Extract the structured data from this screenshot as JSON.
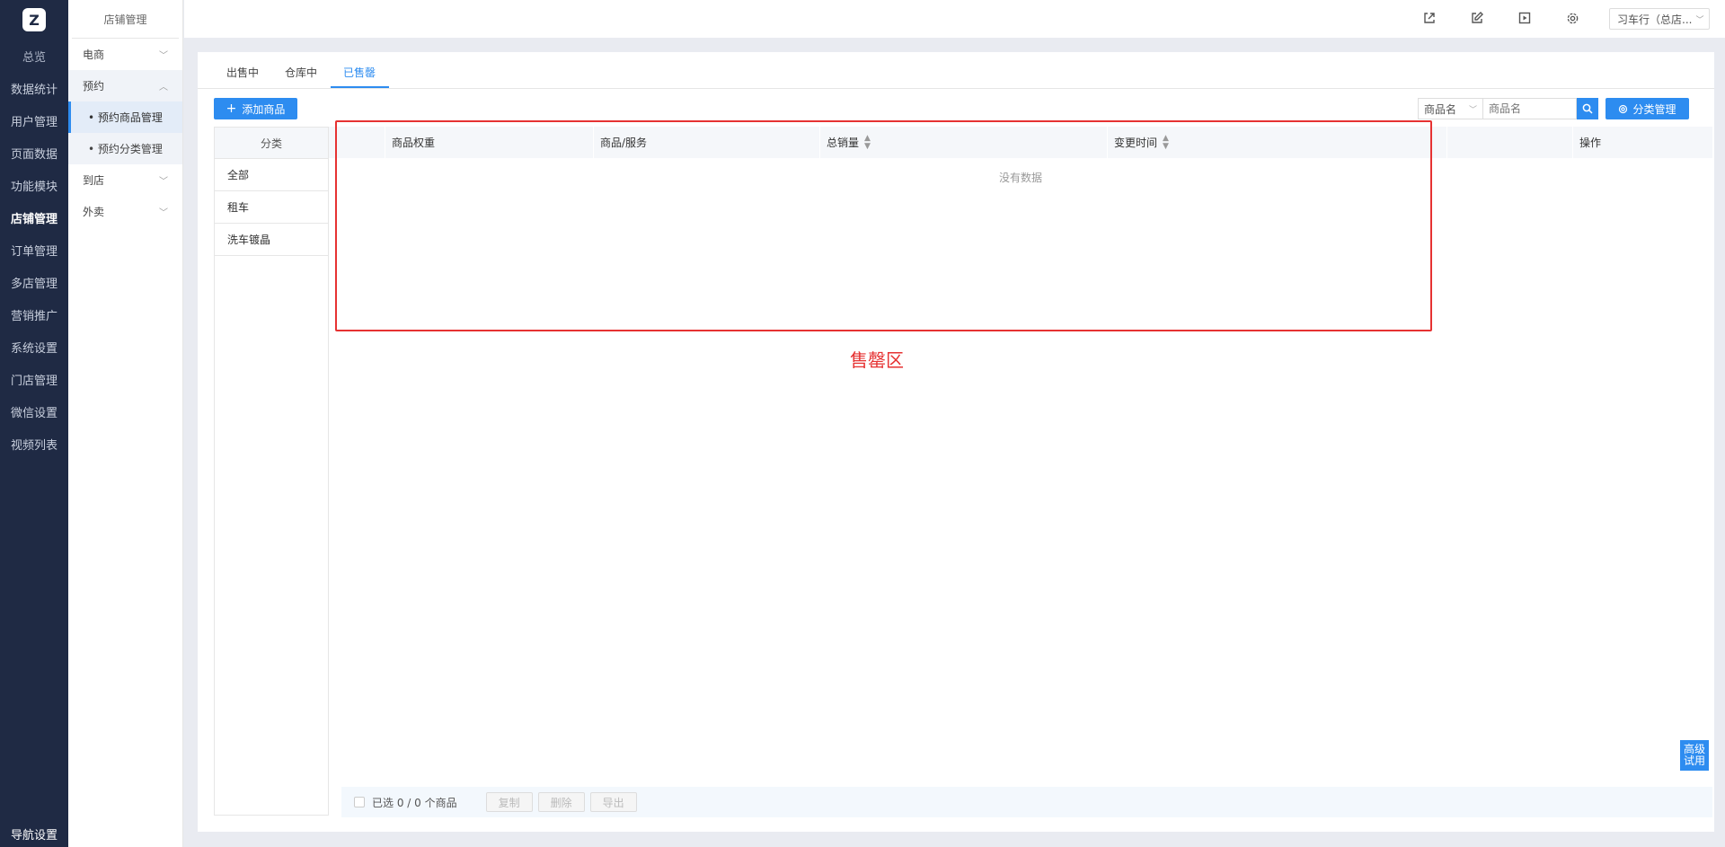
{
  "rail": {
    "items": [
      "总览",
      "数据统计",
      "用户管理",
      "页面数据",
      "功能模块",
      "店铺管理",
      "订单管理",
      "多店管理",
      "营销推广",
      "系统设置",
      "门店管理",
      "微信设置",
      "视频列表"
    ],
    "bottom": "导航设置"
  },
  "sub": {
    "title": "店铺管理",
    "groups": [
      "电商",
      "预约",
      "到店",
      "外卖"
    ],
    "leaves": [
      "• 预约商品管理",
      "• 预约分类管理"
    ]
  },
  "topbar": {
    "store": "习车行（总店..."
  },
  "tabs": [
    "出售中",
    "仓库中",
    "已售罄"
  ],
  "toolbar": {
    "add_label": "添加商品",
    "search_field": "商品名",
    "search_placeholder": "商品名",
    "category_label": "分类管理"
  },
  "categories": {
    "header": "分类",
    "items": [
      "全部",
      "租车",
      "洗车镀晶"
    ]
  },
  "table": {
    "columns": [
      "商品权重",
      "商品/服务",
      "总销量",
      "变更时间",
      "操作"
    ],
    "empty": "没有数据"
  },
  "annotation": "售罄区",
  "footer": {
    "selected": "已选 0 / 0 个商品",
    "buttons": [
      "复制",
      "删除",
      "导出"
    ]
  },
  "trial": "高级试用",
  "colors": {
    "accent": "#2d8cf0",
    "rail": "#1f2a44",
    "annotation": "#e63232"
  }
}
